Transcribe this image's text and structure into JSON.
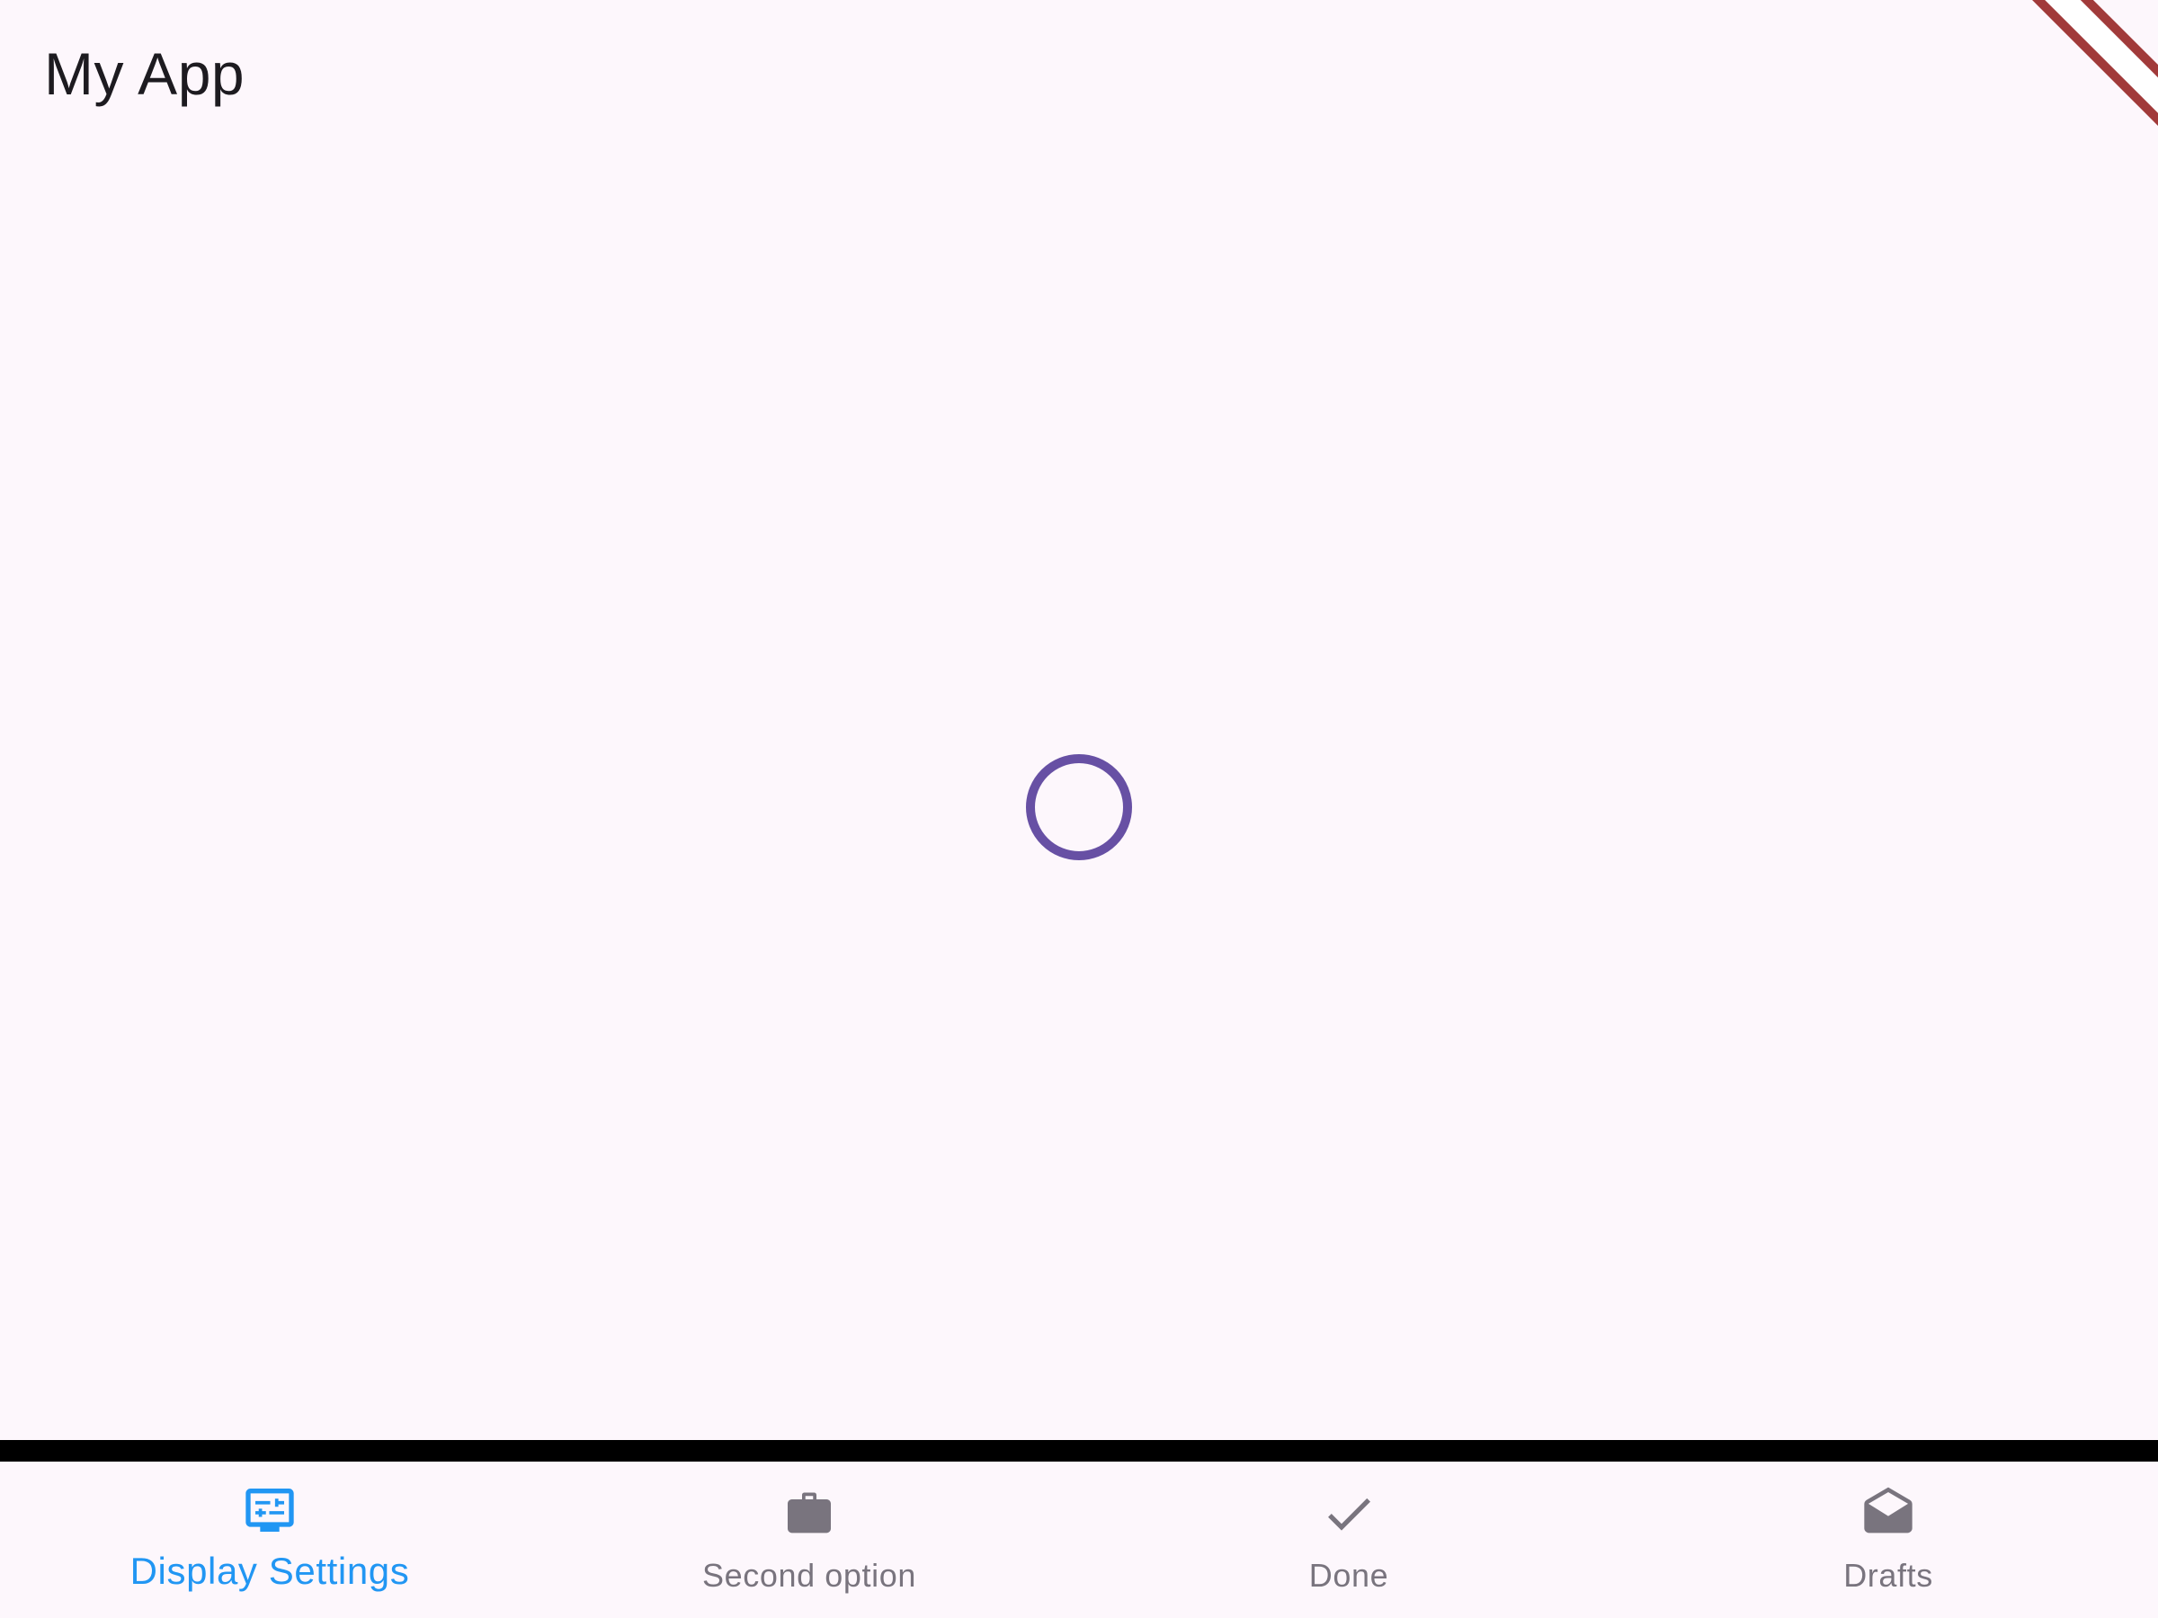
{
  "app_bar": {
    "title": "My App"
  },
  "debug_banner": {
    "color": "#a13a3a"
  },
  "content": {
    "spinner_color": "#6750a4"
  },
  "bottom_nav": {
    "selected_color": "#2196f3",
    "unselected_color": "#79747e",
    "items": [
      {
        "label": "Display Settings",
        "icon": "settings-display-icon",
        "selected": true
      },
      {
        "label": "Second option",
        "icon": "briefcase-icon",
        "selected": false
      },
      {
        "label": "Done",
        "icon": "check-icon",
        "selected": false
      },
      {
        "label": "Drafts",
        "icon": "drafts-icon",
        "selected": false
      }
    ]
  }
}
